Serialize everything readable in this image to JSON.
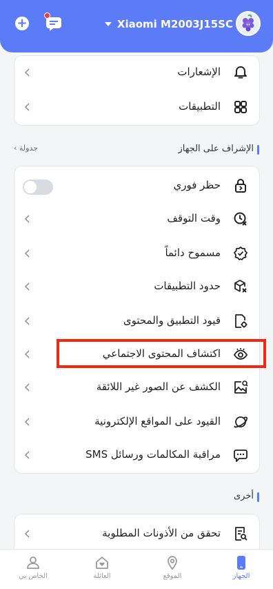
{
  "header": {
    "add_icon": "plus-circle-icon",
    "message_icon": "chat-icon",
    "device_name": "Xiaomi M2003J15SC",
    "avatar_icon": "grape-avatar-icon",
    "accent_color": "#5b7bf7"
  },
  "top_card": {
    "items": [
      {
        "label": "الإشعارات",
        "icon": "bell-icon"
      },
      {
        "label": "التطبيقات",
        "icon": "apps-grid-icon"
      }
    ]
  },
  "device_section": {
    "title": "الإشراف على الجهاز",
    "schedule_link": "جدولة",
    "items": [
      {
        "label": "حظر فوري",
        "icon": "lock-icon",
        "control": "toggle",
        "toggle_on": false
      },
      {
        "label": "وقت التوقف",
        "icon": "clock-off-icon"
      },
      {
        "label": "مسموح دائماً",
        "icon": "badge-check-icon"
      },
      {
        "label": "حدود التطبيقات",
        "icon": "cube-limit-icon"
      },
      {
        "label": "قيود التطبيق والمحتوى",
        "icon": "document-gear-icon"
      },
      {
        "label": "اكتشاف المحتوى الاجتماعي",
        "icon": "eye-icon"
      },
      {
        "label": "الكشف عن الصور غير اللائقة",
        "icon": "image-alert-icon"
      },
      {
        "label": "القيود على المواقع الإلكترونية",
        "icon": "planet-icon"
      },
      {
        "label": "مراقبة المكالمات ورسائل SMS",
        "icon": "sms-chat-icon"
      }
    ]
  },
  "other_section": {
    "title": "أخرى",
    "items": [
      {
        "label": "تحقق من الأذونات المطلوبة",
        "icon": "checklist-icon"
      }
    ]
  },
  "bottom_nav": {
    "items": [
      {
        "label": "الخاص بي",
        "icon": "person-icon",
        "active": false
      },
      {
        "label": "العائلة",
        "icon": "family-heart-icon",
        "active": false
      },
      {
        "label": "الموقع",
        "icon": "location-pin-icon",
        "active": false
      },
      {
        "label": "الجهاز",
        "icon": "phone-icon",
        "active": true
      }
    ]
  },
  "highlight_color": "#ef2a10"
}
